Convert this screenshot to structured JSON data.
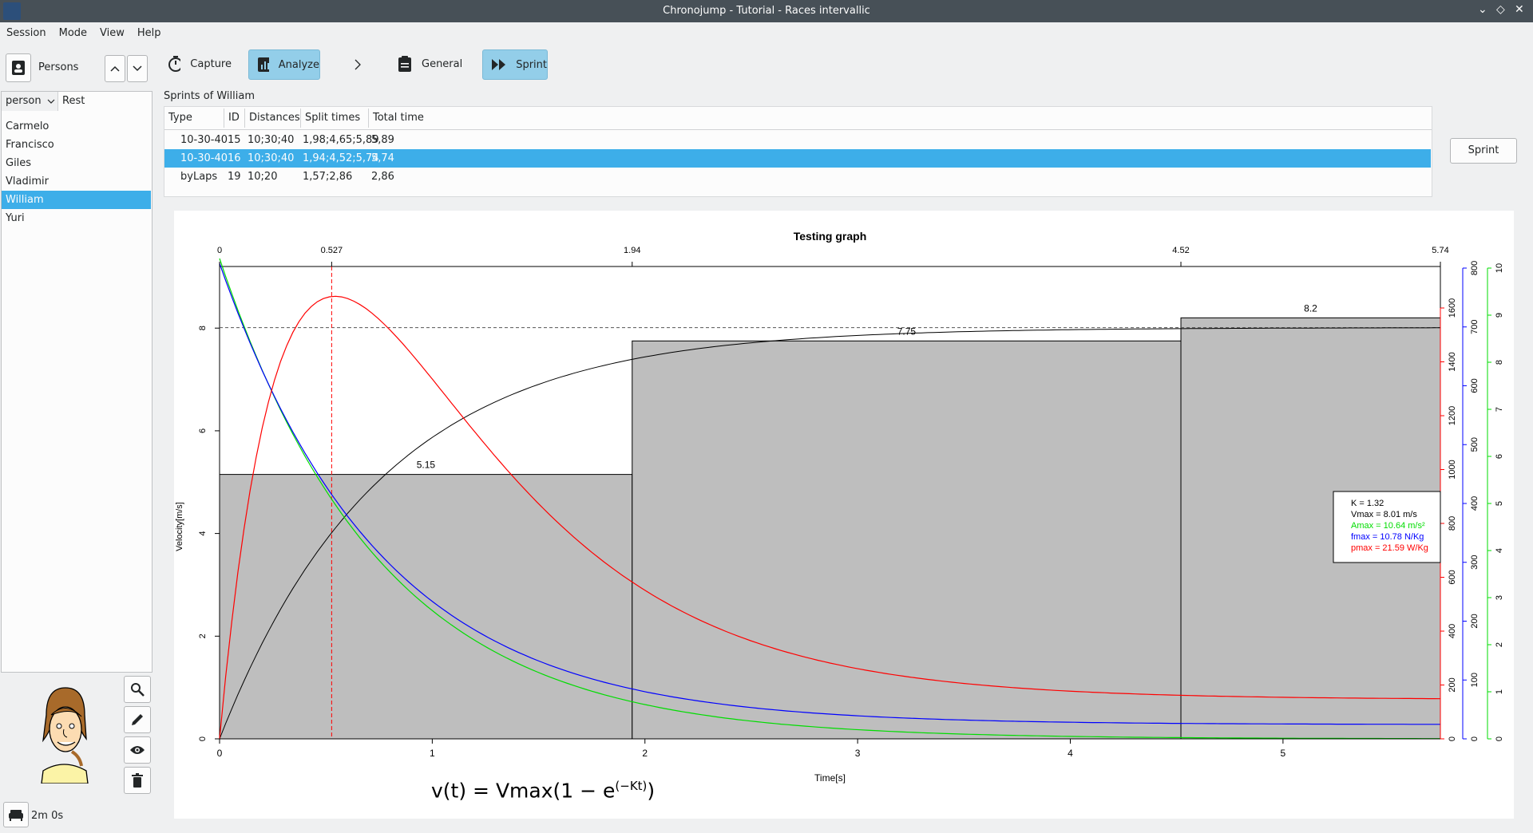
{
  "window": {
    "title": "Chronojump - Tutorial - Races intervallic"
  },
  "menu": [
    "Session",
    "Mode",
    "View",
    "Help"
  ],
  "toolbar": {
    "persons_label": "Persons",
    "capture_label": "Capture",
    "analyze_label": "Analyze",
    "general_label": "General",
    "sprint_label": "Sprint"
  },
  "persons": {
    "col_person": "person",
    "col_rest": "Rest",
    "items": [
      "Carmelo",
      "Francisco",
      "Giles",
      "Vladimir",
      "William",
      "Yuri"
    ],
    "selected": "William"
  },
  "timer": "2m 0s",
  "sprints": {
    "title": "Sprints of William",
    "columns": [
      "Type",
      "ID",
      "Distances",
      "Split times",
      "Total time"
    ],
    "rows": [
      [
        "10-30-40",
        "15",
        "10;30;40",
        "1,98;4,65;5,89",
        "5,89"
      ],
      [
        "10-30-40",
        "16",
        "10;30;40",
        "1,94;4,52;5,74",
        "5,74"
      ],
      [
        "byLaps",
        "19",
        "10;20",
        "1,57;2,86",
        "2,86"
      ]
    ],
    "selected_row": 1,
    "button_label": "Sprint"
  },
  "chart_data": {
    "type": "bar",
    "title": "Testing graph",
    "xlabel": "Time[s]",
    "ylabel": "Velocity[m/s]",
    "xlim": [
      0,
      5.74
    ],
    "ylim": [
      0,
      9.2
    ],
    "x_ticks": [
      "0",
      "1",
      "2",
      "3",
      "4",
      "5"
    ],
    "y_ticks": [
      "0",
      "2",
      "4",
      "6",
      "8"
    ],
    "top_ticks": [
      "0",
      "0.527",
      "1.94",
      "4.52",
      "5.74"
    ],
    "right_red_ticks": [
      "0",
      "200",
      "400",
      "600",
      "800",
      "1000",
      "1200",
      "1400",
      "1600"
    ],
    "right_blue_ticks": [
      "0",
      "100",
      "200",
      "300",
      "400",
      "500",
      "600",
      "700",
      "800"
    ],
    "right_green_ticks": [
      "0",
      "1",
      "2",
      "3",
      "4",
      "5",
      "6",
      "7",
      "8",
      "9",
      "10"
    ],
    "bars": [
      {
        "x0": 0,
        "x1": 1.94,
        "value": 5.15,
        "label": "5.15"
      },
      {
        "x0": 1.94,
        "x1": 4.52,
        "value": 7.75,
        "label": "7.75"
      },
      {
        "x0": 4.52,
        "x1": 5.74,
        "value": 8.2,
        "label": "8.2"
      }
    ],
    "model": {
      "K": 1.32,
      "Vmax": 8.01,
      "tpeak": 0.527
    },
    "series": [
      {
        "curve": "velocity",
        "color": "#000000"
      },
      {
        "curve": "acceleration",
        "color": "#00dd00"
      },
      {
        "curve": "force",
        "color": "#0000ff"
      },
      {
        "curve": "power",
        "color": "#ff0000"
      }
    ],
    "legend": {
      "placement": "right",
      "items": [
        {
          "text": "K = 1.32",
          "color": "#000000"
        },
        {
          "text": "Vmax = 8.01 m/s",
          "color": "#000000"
        },
        {
          "text": "Amax = 10.64 m/s²",
          "color": "#00dd00"
        },
        {
          "text": "fmax = 10.78 N/Kg",
          "color": "#0000ff"
        },
        {
          "text": "pmax = 21.59 W/Kg",
          "color": "#ff0000"
        }
      ]
    },
    "equation": "v(t) = Vmax(1 − e",
    "equation_exp": "(−Kt)",
    "equation_close": ")"
  }
}
